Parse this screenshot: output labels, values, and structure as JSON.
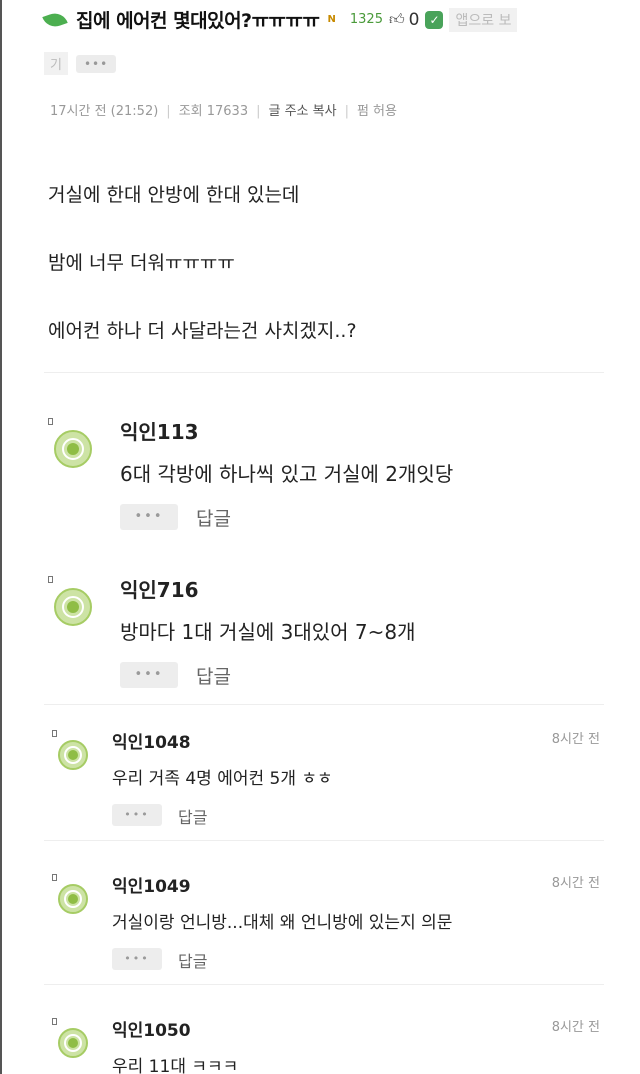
{
  "post": {
    "title": "집에 에어컨 몇대있어?ㅠㅠㅠㅠ",
    "badge": "N",
    "like_count": "1325",
    "comment_count": "0",
    "app_check": "✓",
    "app_open_label_1": "앱으로 보",
    "app_open_label_2": "기",
    "more": "•••",
    "meta": {
      "time": "17시간 전 (21:52)",
      "views": "조회 17633",
      "copy_url": "글 주소 복사",
      "share": "펌 허용"
    },
    "lines": [
      "거실에 한대 안방에 한대 있는데",
      "밤에 너무 더워ㅠㅠㅠㅠ",
      "에어컨 하나 더 사달라는건 사치겠지..?"
    ]
  },
  "comments": [
    {
      "name": "익인113",
      "text": "6대 각방에 하나씩 있고 거실에 2개잇당",
      "reply": "답글",
      "more": "•••",
      "time": ""
    },
    {
      "name": "익인716",
      "text": "방마다 1대 거실에 3대있어 7~8개",
      "reply": "답글",
      "more": "•••",
      "time": ""
    },
    {
      "name": "익인1048",
      "text": "우리 거족 4명 에어컨 5개 ㅎㅎ",
      "reply": "답글",
      "more": "•••",
      "time": "8시간 전"
    },
    {
      "name": "익인1049",
      "text": "거실이랑 언니방...대체 왜 언니방에 있는지 의문",
      "reply": "답글",
      "more": "•••",
      "time": "8시간 전"
    },
    {
      "name": "익인1050",
      "text": "우리 11대 ㅋㅋㅋ",
      "reply": "",
      "more": "",
      "time": "8시간 전"
    }
  ],
  "colors": {
    "accent_green": "#8fbd45",
    "badge": "#c78a00"
  }
}
